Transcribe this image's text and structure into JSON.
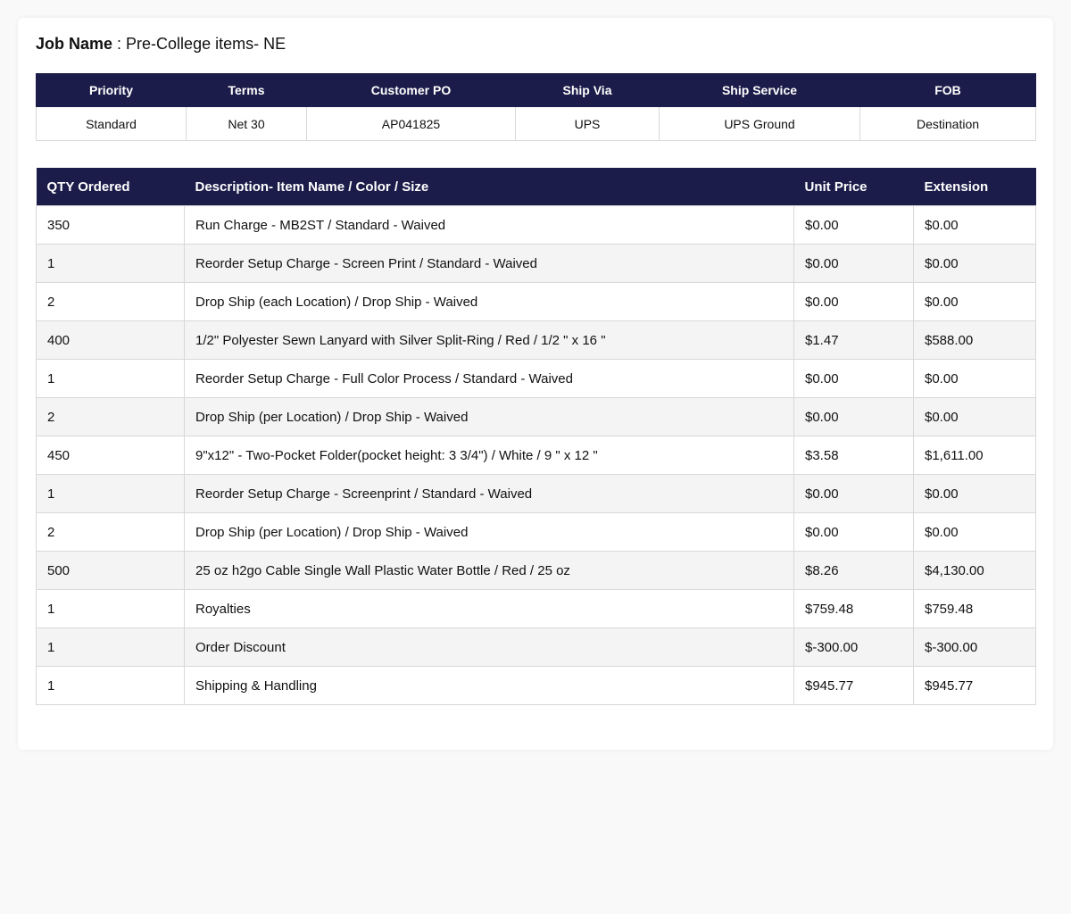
{
  "job": {
    "label": "Job Name",
    "separator": " : ",
    "value": "Pre-College items- NE"
  },
  "order_info": {
    "headers": [
      "Priority",
      "Terms",
      "Customer PO",
      "Ship Via",
      "Ship Service",
      "FOB"
    ],
    "values": [
      "Standard",
      "Net 30",
      "AP041825",
      "UPS",
      "UPS Ground",
      "Destination"
    ]
  },
  "items_table": {
    "headers": [
      "QTY Ordered",
      "Description- Item Name / Color / Size",
      "Unit Price",
      "Extension"
    ],
    "rows": [
      {
        "qty": "350",
        "description": "Run Charge - MB2ST / Standard - Waived",
        "unit_price": "$0.00",
        "extension": "$0.00"
      },
      {
        "qty": "1",
        "description": "Reorder Setup Charge - Screen Print / Standard - Waived",
        "unit_price": "$0.00",
        "extension": "$0.00"
      },
      {
        "qty": "2",
        "description": "Drop Ship (each Location) / Drop Ship - Waived",
        "unit_price": "$0.00",
        "extension": "$0.00"
      },
      {
        "qty": "400",
        "description": "1/2\" Polyester Sewn Lanyard with Silver Split-Ring / Red / 1/2 \" x 16 \"",
        "unit_price": "$1.47",
        "extension": "$588.00"
      },
      {
        "qty": "1",
        "description": "Reorder Setup Charge - Full Color Process / Standard - Waived",
        "unit_price": "$0.00",
        "extension": "$0.00"
      },
      {
        "qty": "2",
        "description": "Drop Ship (per Location) / Drop Ship - Waived",
        "unit_price": "$0.00",
        "extension": "$0.00"
      },
      {
        "qty": "450",
        "description": "9\"x12\" - Two-Pocket Folder(pocket height: 3 3/4\") / White / 9 \" x 12 \"",
        "unit_price": "$3.58",
        "extension": "$1,611.00"
      },
      {
        "qty": "1",
        "description": "Reorder Setup Charge - Screenprint / Standard - Waived",
        "unit_price": "$0.00",
        "extension": "$0.00"
      },
      {
        "qty": "2",
        "description": "Drop Ship (per Location) / Drop Ship - Waived",
        "unit_price": "$0.00",
        "extension": "$0.00"
      },
      {
        "qty": "500",
        "description": "25 oz h2go Cable Single Wall Plastic Water Bottle / Red / 25 oz",
        "unit_price": "$8.26",
        "extension": "$4,130.00"
      },
      {
        "qty": "1",
        "description": "Royalties",
        "unit_price": "$759.48",
        "extension": "$759.48"
      },
      {
        "qty": "1",
        "description": "Order Discount",
        "unit_price": "$-300.00",
        "extension": "$-300.00"
      },
      {
        "qty": "1",
        "description": "Shipping & Handling",
        "unit_price": "$945.77",
        "extension": "$945.77"
      }
    ]
  },
  "colors": {
    "header_bg": "#1c1c4a",
    "row_alt_bg": "#f4f4f4"
  }
}
